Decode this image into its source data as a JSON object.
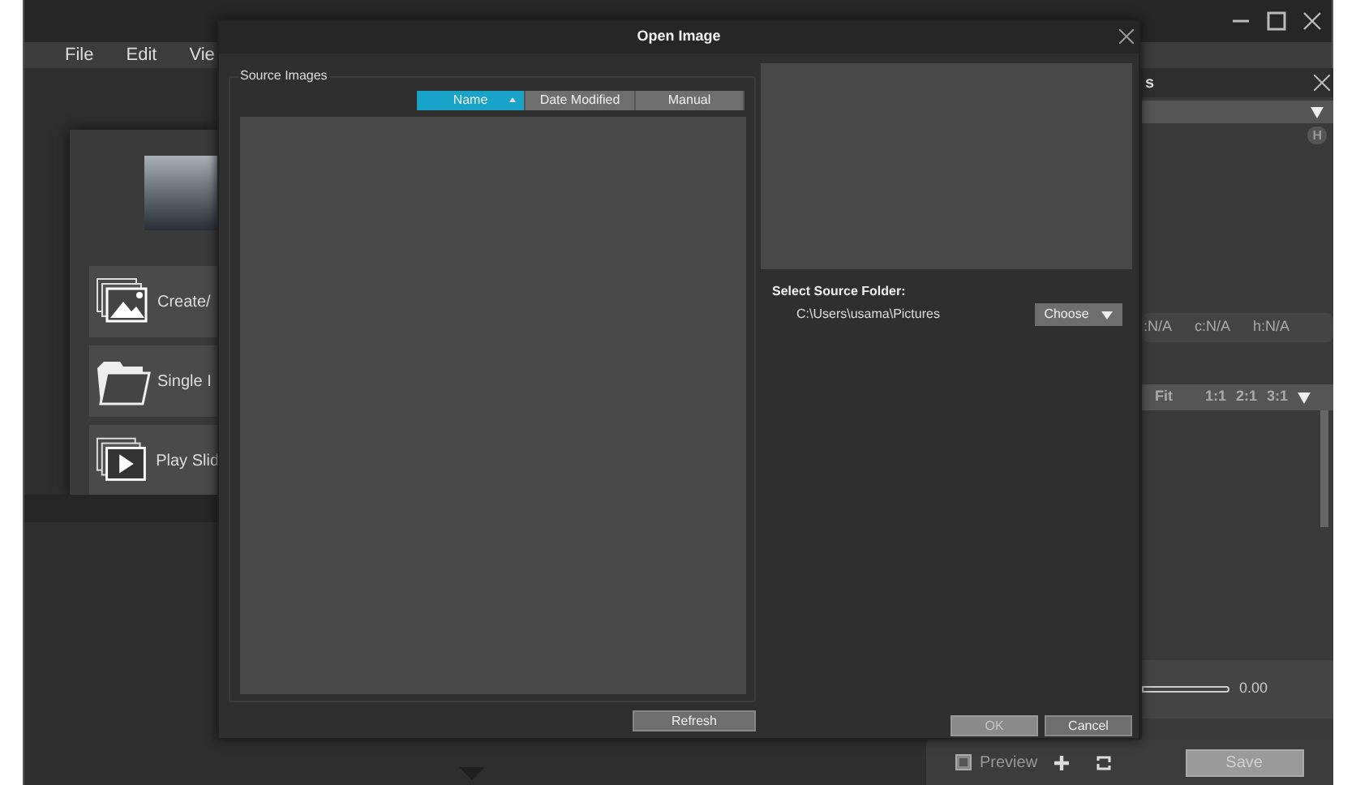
{
  "app": {
    "menu": [
      {
        "label": "File"
      },
      {
        "label": "Edit"
      },
      {
        "label": "Vie"
      }
    ],
    "launch_items": [
      {
        "label": "Create/",
        "kind": "stack"
      },
      {
        "label": "Single I",
        "kind": "folder"
      },
      {
        "label": "Play Slid",
        "kind": "play"
      }
    ],
    "panel": {
      "title": "s",
      "badge": "H",
      "readouts": [
        ":N/A",
        "c:N/A",
        "h:N/A"
      ],
      "zoom_options": [
        "Fit",
        "1:1",
        "2:1",
        "3:1"
      ],
      "slider_value": "0.00"
    },
    "bottom_bar": {
      "preview_checked": true,
      "preview_label": "Preview",
      "save": {
        "label": "Save",
        "disabled": true
      }
    }
  },
  "dialog": {
    "title": "Open Image",
    "group_label": "Source Images",
    "sort_buttons": [
      {
        "label": "Name",
        "selected": true
      },
      {
        "label": "Date Modified",
        "selected": false
      },
      {
        "label": "Manual",
        "selected": false
      }
    ],
    "folder_label": "Select Source Folder:",
    "folder_path": "C:\\Users\\usama\\Pictures",
    "choose_label": "Choose",
    "refresh": {
      "label": "Refresh",
      "disabled": false
    },
    "ok": {
      "label": "OK",
      "disabled": true
    },
    "cancel": {
      "label": "Cancel",
      "disabled": false
    }
  }
}
